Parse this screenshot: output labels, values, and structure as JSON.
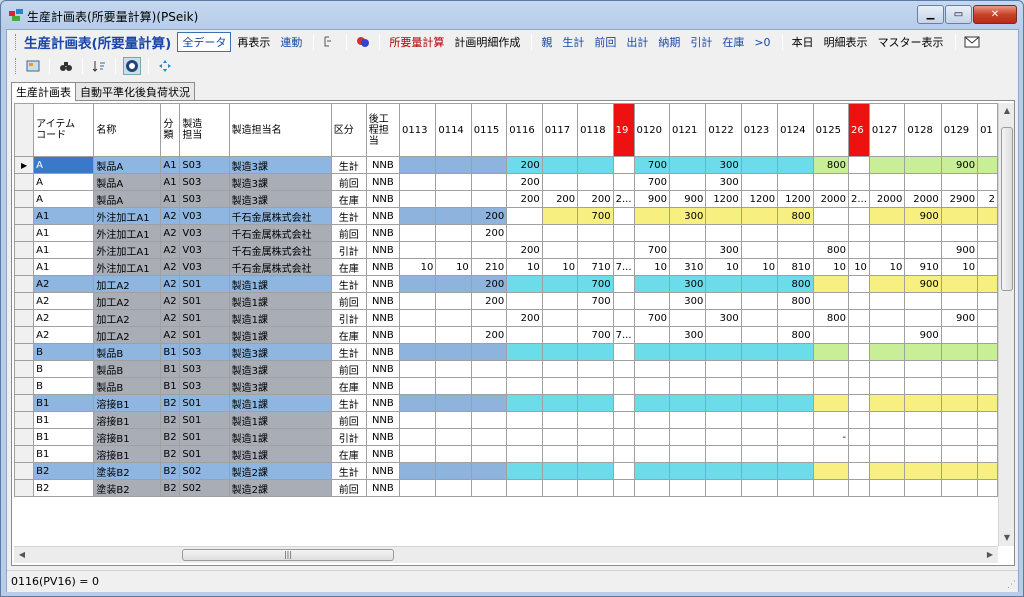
{
  "window": {
    "title": "生産計画表(所要量計算)(PSeik)"
  },
  "toolbar": {
    "title": "生産計画表(所要量計算)",
    "all_data": "全データ",
    "redisplay": "再表示",
    "link": "連動",
    "req_calc": "所要量計算",
    "plan_detail": "計画明細作成",
    "parent": "親",
    "production": "生計",
    "prev": "前回",
    "outbound": "出計",
    "due": "納期",
    "pull": "引計",
    "stock": "在庫",
    "gt0": ">0",
    "today": "本日",
    "detail_view": "明細表示",
    "master_view": "マスター表示"
  },
  "tabs": [
    "生産計画表",
    "自動平準化後負荷状況"
  ],
  "grid": {
    "columns": [
      "アイテム\nコード",
      "名称",
      "分\n類",
      "製造\n担当",
      "製造担当名",
      "区分",
      "後工\n程担\n当",
      "0113",
      "0114",
      "0115",
      "0116",
      "0117",
      "0118",
      "19",
      "0120",
      "0121",
      "0122",
      "0123",
      "0124",
      "0125",
      "26",
      "0127",
      "0128",
      "0129",
      "01"
    ],
    "rows": [
      {
        "code": "A",
        "name": "製品A",
        "cls": "A1",
        "dept": "S03",
        "deptname": "製造3課",
        "kbn": "生計",
        "post": "NNB",
        "vals": [
          "",
          "",
          "",
          "200",
          "",
          "",
          "",
          "700",
          "",
          "300",
          "",
          "",
          "800",
          "",
          "",
          "",
          "900",
          ""
        ]
      },
      {
        "code": "A",
        "name": "製品A",
        "cls": "A1",
        "dept": "S03",
        "deptname": "製造3課",
        "kbn": "前回",
        "post": "NNB",
        "vals": [
          "",
          "",
          "",
          "200",
          "",
          "",
          "",
          "700",
          "",
          "300",
          "",
          "",
          "",
          "",
          "",
          "",
          "",
          ""
        ]
      },
      {
        "code": "A",
        "name": "製品A",
        "cls": "A1",
        "dept": "S03",
        "deptname": "製造3課",
        "kbn": "在庫",
        "post": "NNB",
        "vals": [
          "",
          "",
          "",
          "200",
          "200",
          "200",
          "2...",
          "900",
          "900",
          "1200",
          "1200",
          "1200",
          "2000",
          "2...",
          "2000",
          "2000",
          "2900",
          "2"
        ]
      },
      {
        "code": "A1",
        "name": "外注加工A1",
        "cls": "A2",
        "dept": "V03",
        "deptname": "千石金属株式会社",
        "kbn": "生計",
        "post": "NNB",
        "vals": [
          "",
          "",
          "200",
          "",
          "",
          "700",
          "",
          "",
          "300",
          "",
          "",
          "800",
          "",
          "",
          "",
          "900",
          "",
          ""
        ]
      },
      {
        "code": "A1",
        "name": "外注加工A1",
        "cls": "A2",
        "dept": "V03",
        "deptname": "千石金属株式会社",
        "kbn": "前回",
        "post": "NNB",
        "vals": [
          "",
          "",
          "200",
          "",
          "",
          "",
          "",
          "",
          "",
          "",
          "",
          "",
          "",
          "",
          "",
          "",
          "",
          ""
        ]
      },
      {
        "code": "A1",
        "name": "外注加工A1",
        "cls": "A2",
        "dept": "V03",
        "deptname": "千石金属株式会社",
        "kbn": "引計",
        "post": "NNB",
        "vals": [
          "",
          "",
          "",
          "200",
          "",
          "",
          "",
          "700",
          "",
          "300",
          "",
          "",
          "800",
          "",
          "",
          "",
          "900",
          ""
        ]
      },
      {
        "code": "A1",
        "name": "外注加工A1",
        "cls": "A2",
        "dept": "V03",
        "deptname": "千石金属株式会社",
        "kbn": "在庫",
        "post": "NNB",
        "vals": [
          "10",
          "10",
          "210",
          "10",
          "10",
          "710",
          "7...",
          "10",
          "310",
          "10",
          "10",
          "810",
          "10",
          "10",
          "10",
          "910",
          "10",
          ""
        ]
      },
      {
        "code": "A2",
        "name": "加工A2",
        "cls": "A2",
        "dept": "S01",
        "deptname": "製造1課",
        "kbn": "生計",
        "post": "NNB",
        "vals": [
          "",
          "",
          "200",
          "",
          "",
          "700",
          "",
          "",
          "300",
          "",
          "",
          "800",
          "",
          "",
          "",
          "900",
          "",
          ""
        ]
      },
      {
        "code": "A2",
        "name": "加工A2",
        "cls": "A2",
        "dept": "S01",
        "deptname": "製造1課",
        "kbn": "前回",
        "post": "NNB",
        "vals": [
          "",
          "",
          "200",
          "",
          "",
          "700",
          "",
          "",
          "300",
          "",
          "",
          "800",
          "",
          "",
          "",
          "",
          "",
          ""
        ]
      },
      {
        "code": "A2",
        "name": "加工A2",
        "cls": "A2",
        "dept": "S01",
        "deptname": "製造1課",
        "kbn": "引計",
        "post": "NNB",
        "vals": [
          "",
          "",
          "",
          "200",
          "",
          "",
          "",
          "700",
          "",
          "300",
          "",
          "",
          "800",
          "",
          "",
          "",
          "900",
          ""
        ]
      },
      {
        "code": "A2",
        "name": "加工A2",
        "cls": "A2",
        "dept": "S01",
        "deptname": "製造1課",
        "kbn": "在庫",
        "post": "NNB",
        "vals": [
          "",
          "",
          "200",
          "",
          "",
          "700",
          "7...",
          "",
          "300",
          "",
          "",
          "800",
          "",
          "",
          "",
          "900",
          "",
          ""
        ]
      },
      {
        "code": "B",
        "name": "製品B",
        "cls": "B1",
        "dept": "S03",
        "deptname": "製造3課",
        "kbn": "生計",
        "post": "NNB",
        "vals": [
          "",
          "",
          "",
          "",
          "",
          "",
          "",
          "",
          "",
          "",
          "",
          "",
          "",
          "",
          "",
          "",
          "",
          ""
        ]
      },
      {
        "code": "B",
        "name": "製品B",
        "cls": "B1",
        "dept": "S03",
        "deptname": "製造3課",
        "kbn": "前回",
        "post": "NNB",
        "vals": [
          "",
          "",
          "",
          "",
          "",
          "",
          "",
          "",
          "",
          "",
          "",
          "",
          "",
          "",
          "",
          "",
          "",
          ""
        ]
      },
      {
        "code": "B",
        "name": "製品B",
        "cls": "B1",
        "dept": "S03",
        "deptname": "製造3課",
        "kbn": "在庫",
        "post": "NNB",
        "vals": [
          "",
          "",
          "",
          "",
          "",
          "",
          "",
          "",
          "",
          "",
          "",
          "",
          "",
          "",
          "",
          "",
          "",
          ""
        ]
      },
      {
        "code": "B1",
        "name": "溶接B1",
        "cls": "B2",
        "dept": "S01",
        "deptname": "製造1課",
        "kbn": "生計",
        "post": "NNB",
        "vals": [
          "",
          "",
          "",
          "",
          "",
          "",
          "",
          "",
          "",
          "",
          "",
          "",
          "",
          "",
          "",
          "",
          "",
          ""
        ]
      },
      {
        "code": "B1",
        "name": "溶接B1",
        "cls": "B2",
        "dept": "S01",
        "deptname": "製造1課",
        "kbn": "前回",
        "post": "NNB",
        "vals": [
          "",
          "",
          "",
          "",
          "",
          "",
          "",
          "",
          "",
          "",
          "",
          "",
          "",
          "",
          "",
          "",
          "",
          ""
        ]
      },
      {
        "code": "B1",
        "name": "溶接B1",
        "cls": "B2",
        "dept": "S01",
        "deptname": "製造1課",
        "kbn": "引計",
        "post": "NNB",
        "vals": [
          "",
          "",
          "",
          "",
          "",
          "",
          "",
          "",
          "",
          "",
          "",
          "",
          "-",
          "",
          "",
          "",
          "",
          ""
        ]
      },
      {
        "code": "B1",
        "name": "溶接B1",
        "cls": "B2",
        "dept": "S01",
        "deptname": "製造1課",
        "kbn": "在庫",
        "post": "NNB",
        "vals": [
          "",
          "",
          "",
          "",
          "",
          "",
          "",
          "",
          "",
          "",
          "",
          "",
          "",
          "",
          "",
          "",
          "",
          ""
        ]
      },
      {
        "code": "B2",
        "name": "塗装B2",
        "cls": "B2",
        "dept": "S02",
        "deptname": "製造2課",
        "kbn": "生計",
        "post": "NNB",
        "vals": [
          "",
          "",
          "",
          "",
          "",
          "",
          "",
          "",
          "",
          "",
          "",
          "",
          "",
          "",
          "",
          "",
          "",
          ""
        ]
      },
      {
        "code": "B2",
        "name": "塗装B2",
        "cls": "B2",
        "dept": "S02",
        "deptname": "製造2課",
        "kbn": "前回",
        "post": "NNB",
        "vals": [
          "",
          "",
          "",
          "",
          "",
          "",
          "",
          "",
          "",
          "",
          "",
          "",
          "",
          "",
          "",
          "",
          "",
          ""
        ]
      }
    ]
  },
  "status": {
    "text": "0116(PV16) = 0"
  },
  "colors": {
    "selected": "#3a78c9",
    "plan_row": "#8fb6e0",
    "cyan": "#6ddcea",
    "yellow": "#f7ef80",
    "green": "#c8ef98",
    "holiday": "#ee1111"
  }
}
